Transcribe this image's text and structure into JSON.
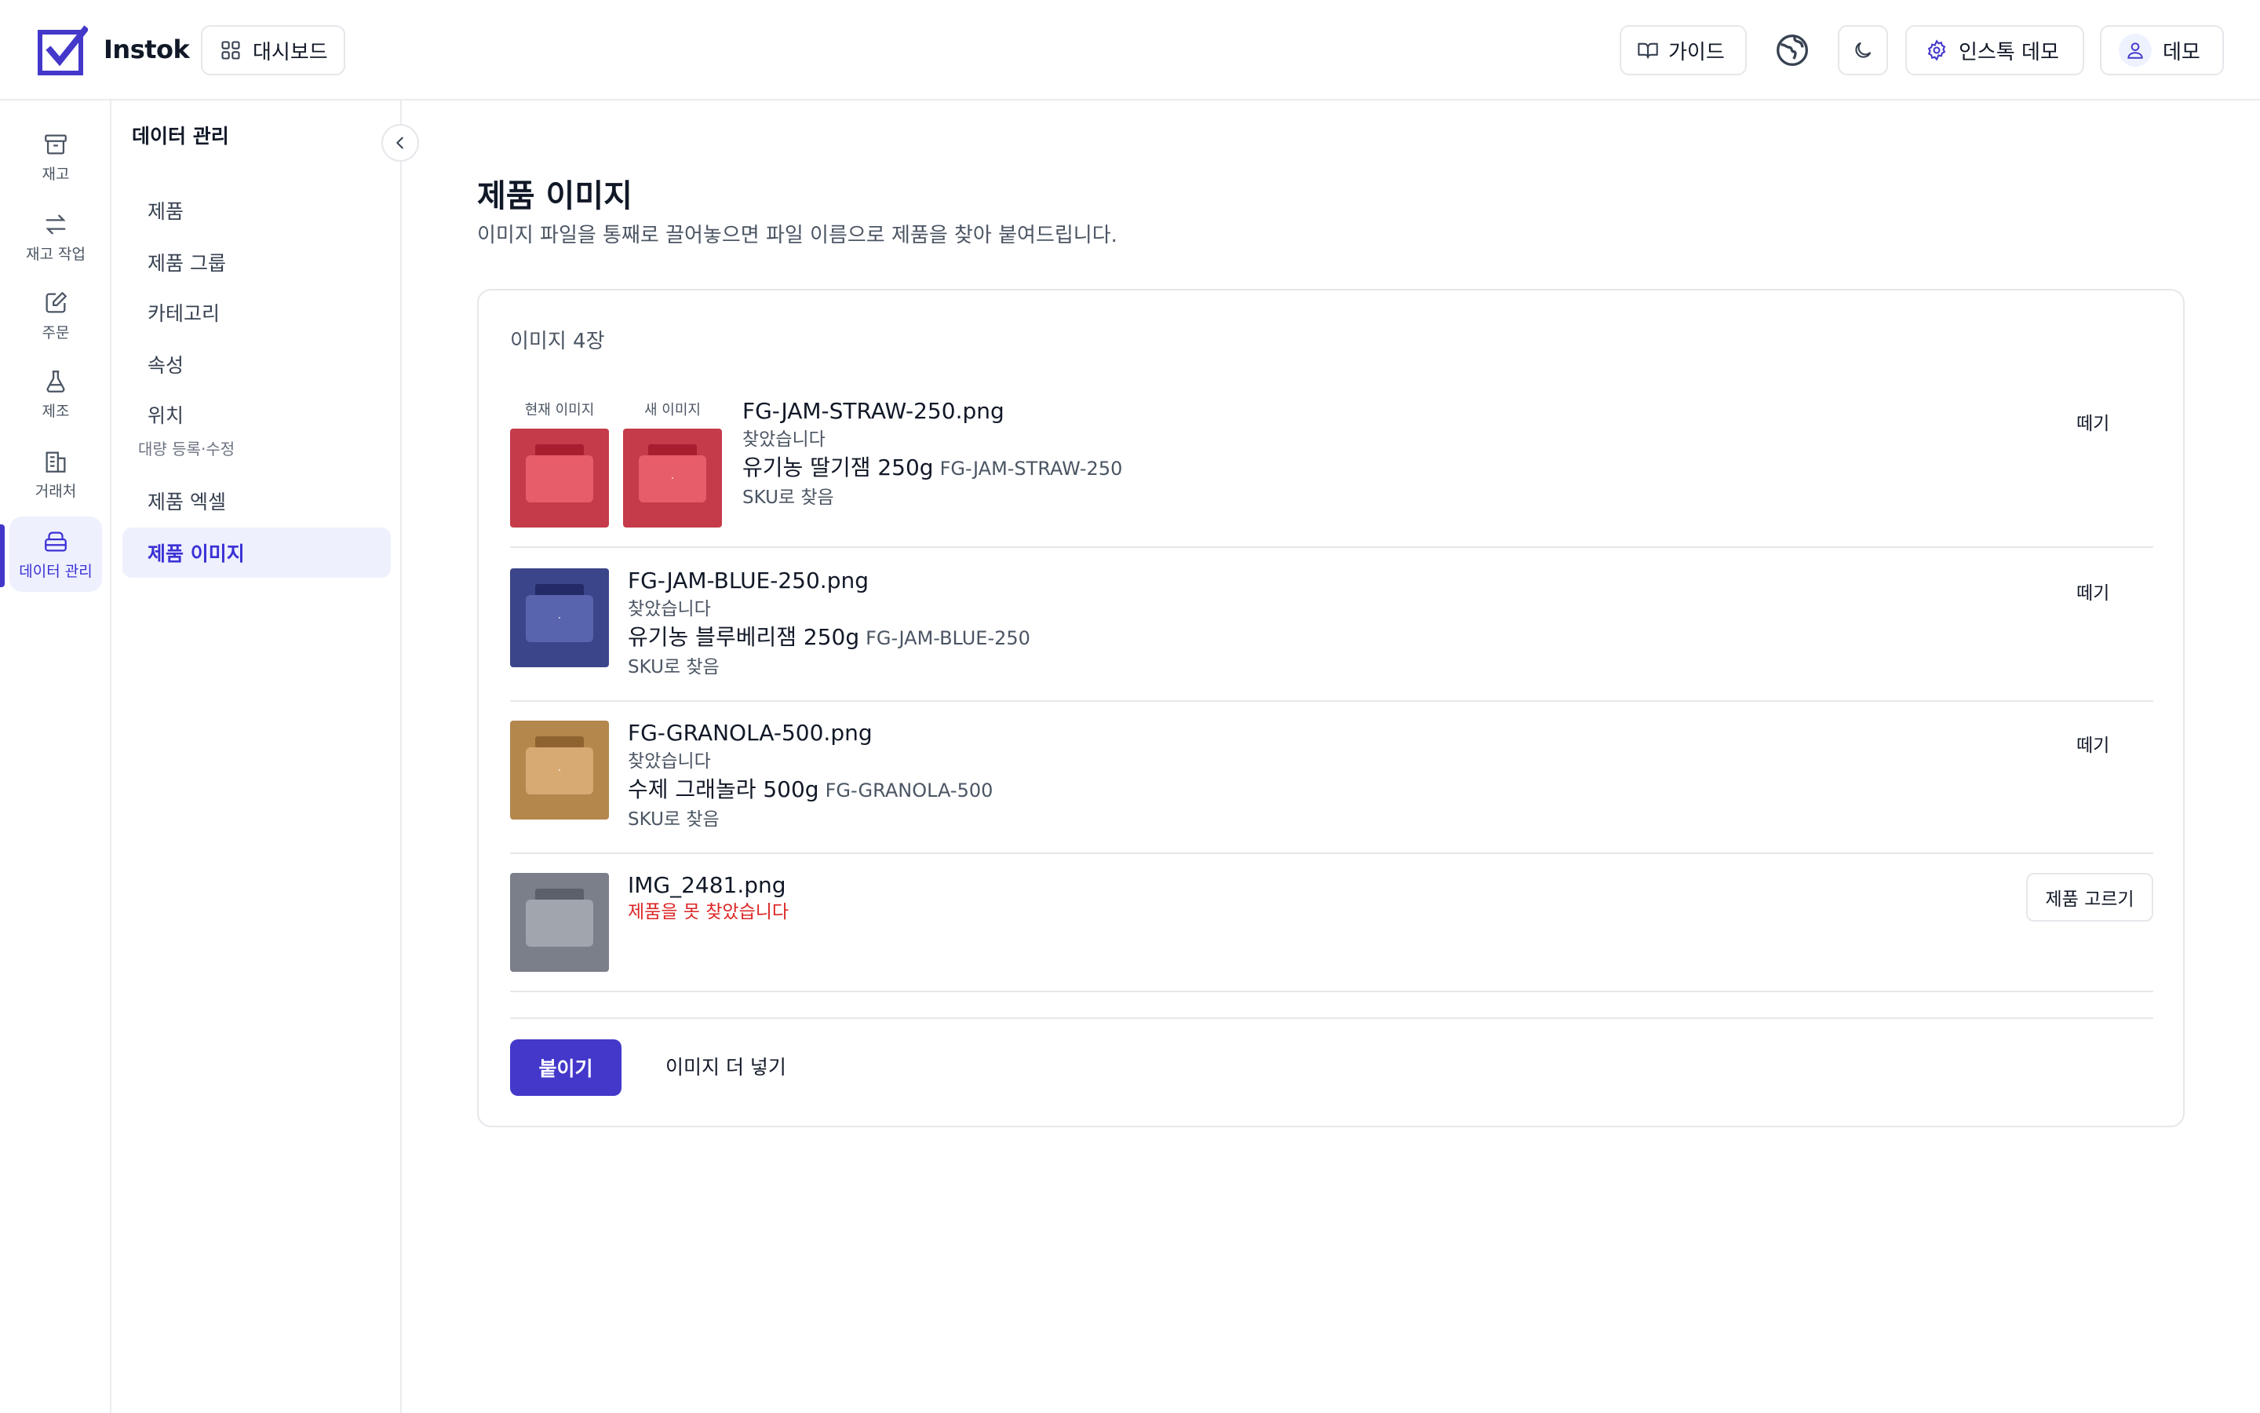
{
  "app": {
    "brand": "Instok",
    "colors": {
      "accent": "#4338ca",
      "error": "#dc2626",
      "active_bg": "#eef0fd"
    }
  },
  "topbar": {
    "dashboard_label": "대시보드",
    "guide_label": "가이드",
    "org_label": "인스톡 데모",
    "user_label": "데모",
    "icons": [
      "dashboard-grid-icon",
      "book-icon",
      "globe-icon",
      "moon-icon",
      "gear-icon",
      "user-icon"
    ]
  },
  "rail": {
    "items": [
      {
        "label": "재고",
        "icon": "archive-icon"
      },
      {
        "label": "재고 작업",
        "icon": "swap-arrows-icon"
      },
      {
        "label": "주문",
        "icon": "edit-note-icon"
      },
      {
        "label": "제조",
        "icon": "flask-icon"
      },
      {
        "label": "거래처",
        "icon": "building-icon"
      },
      {
        "label": "데이터 관리",
        "icon": "database-icon",
        "active": true
      }
    ]
  },
  "subnav": {
    "title": "데이터 관리",
    "items": [
      "제품",
      "제품 그룹",
      "카테고리",
      "속성",
      "위치"
    ],
    "section_label": "대량 등록·수정",
    "bulk_items": [
      "제품 엑셀",
      "제품 이미지"
    ],
    "active_item": "제품 이미지"
  },
  "page": {
    "title": "제품 이미지",
    "subtitle": "이미지 파일을 통째로 끌어놓으면 파일 이름으로 제품을 찾아 붙여드립니다."
  },
  "uploads": {
    "count_label": "이미지 4장",
    "current_image_caption": "현재 이미지",
    "new_image_caption": "새 이미지",
    "detach_label": "떼기",
    "pick_product_label": "제품 고르기",
    "rows": [
      {
        "file": "FG-JAM-STRAW-250.png",
        "status": "찾았습니다",
        "product": "유기농 딸기잼 250g",
        "sku": "FG-JAM-STRAW-250",
        "matched_by": "SKU로 찾음",
        "thumb_color": "#c53b4a"
      },
      {
        "file": "FG-JAM-BLUE-250.png",
        "status": "찾았습니다",
        "product": "유기농 블루베리잼 250g",
        "sku": "FG-JAM-BLUE-250",
        "matched_by": "SKU로 찾음",
        "thumb_color": "#3b4589"
      },
      {
        "file": "FG-GRANOLA-500.png",
        "status": "찾았습니다",
        "product": "수제 그래놀라 500g",
        "sku": "FG-GRANOLA-500",
        "matched_by": "SKU로 찾음",
        "thumb_color": "#b4874d"
      },
      {
        "file": "IMG_2481.png",
        "status": "제품을 못 찾았습니다",
        "thumb_color": "#7b7f8a"
      }
    ],
    "apply_label": "붙이기",
    "add_more_label": "이미지 더 넣기"
  }
}
